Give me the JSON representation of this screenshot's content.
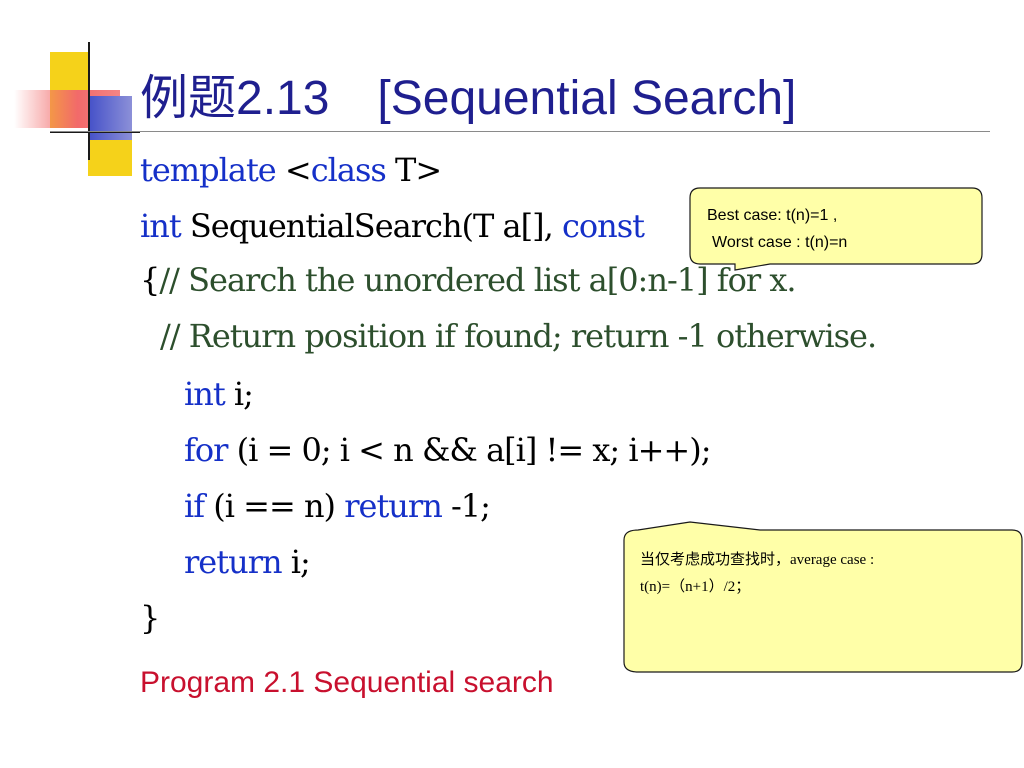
{
  "slide": {
    "title": "例题2.13　[Sequential Search]",
    "caption": "Program 2.1 Sequential search"
  },
  "code": {
    "line1_kw": "template",
    "line1_mid": " <",
    "line1_kw2": "class",
    "line1_rest": " T>",
    "line2_kw": "int",
    "line2_mid": " SequentialSearch(T a[], ",
    "line2_kw2": "const",
    "line3_brace": "{",
    "line3_comment": "// Search the unordered list a[0:n-1] for x.",
    "line4_comment": "// Return position if found; return -1 otherwise.",
    "line5_kw": "int",
    "line5_rest": " i;",
    "line6_kw": "for",
    "line6_rest": " (i = 0; i < n && a[i] != x; i++);",
    "line7_kw": "if",
    "line7_mid": " (i == n) ",
    "line7_kw2": "return",
    "line7_rest": " -1;",
    "line8_kw": "return",
    "line8_rest": " i;",
    "line9_brace": "}"
  },
  "callouts": {
    "best_worst": {
      "line1": "Best case: t(n)=1 ,",
      "line2": "Worst case : t(n)=n"
    },
    "average": {
      "line1": "当仅考虑成功查找时，average case :",
      "line2": "t(n)=（n+1）/2；"
    }
  },
  "colors": {
    "title": "#1f1f8f",
    "keyword": "#1530c8",
    "caption": "#c8102e",
    "callout_fill": "#ffffa8"
  }
}
